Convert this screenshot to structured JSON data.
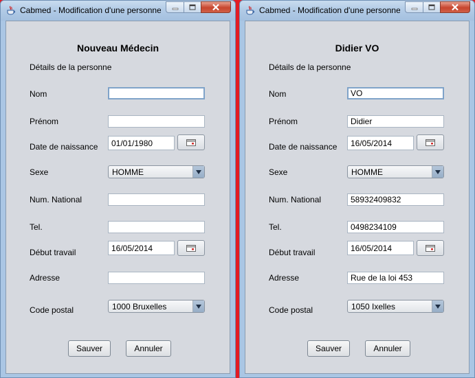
{
  "windows": [
    {
      "title": "Cabmed - Modification d'une personne",
      "heading": "Nouveau Médecin",
      "subheading": "Détails de la personne",
      "labels": {
        "nom": "Nom",
        "prenom": "Prénom",
        "date_naissance": "Date de naissance",
        "sexe": "Sexe",
        "num_national": "Num. National",
        "tel": "Tel.",
        "debut_travail": "Début travail",
        "adresse": "Adresse",
        "code_postal": "Code postal"
      },
      "values": {
        "nom": "",
        "prenom": "",
        "date_naissance": "01/01/1980",
        "sexe": "HOMME",
        "num_national": "",
        "tel": "",
        "debut_travail": "16/05/2014",
        "adresse": "",
        "code_postal": "1000 Bruxelles"
      },
      "buttons": {
        "save": "Sauver",
        "cancel": "Annuler"
      }
    },
    {
      "title": "Cabmed - Modification d'une personne",
      "heading": "Didier VO",
      "subheading": "Détails de la personne",
      "labels": {
        "nom": "Nom",
        "prenom": "Prénom",
        "date_naissance": "Date de naissance",
        "sexe": "Sexe",
        "num_national": "Num. National",
        "tel": "Tel.",
        "debut_travail": "Début travail",
        "adresse": "Adresse",
        "code_postal": "Code postal"
      },
      "values": {
        "nom": "VO",
        "prenom": "Didier",
        "date_naissance": "16/05/2014",
        "sexe": "HOMME",
        "num_national": "58932409832",
        "tel": "0498234109",
        "debut_travail": "16/05/2014",
        "adresse": "Rue de la loi 453",
        "code_postal": "1050 Ixelles"
      },
      "buttons": {
        "save": "Sauver",
        "cancel": "Annuler"
      }
    }
  ],
  "icons": {
    "app": "java-cup-icon",
    "minimize": "minimize-icon",
    "maximize": "maximize-icon",
    "close": "close-icon",
    "calendar": "calendar-icon",
    "dropdown": "chevron-down-icon"
  }
}
